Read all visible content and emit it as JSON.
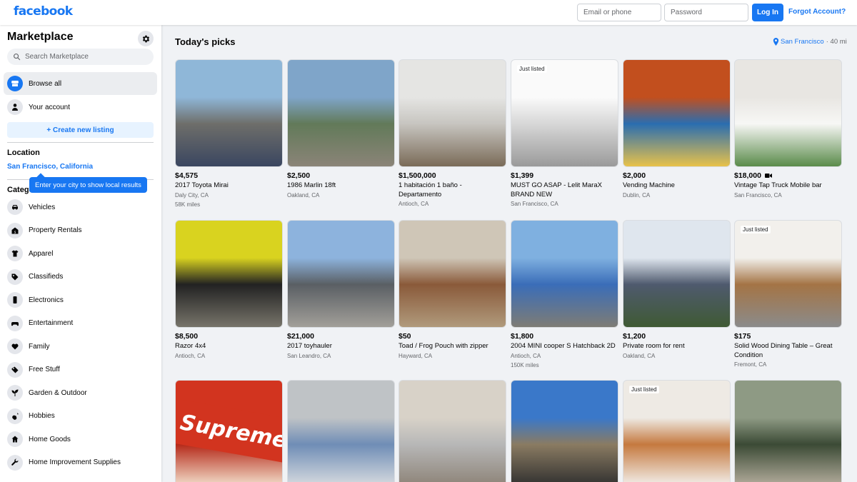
{
  "header": {
    "logo": "facebook",
    "email_placeholder": "Email or phone",
    "password_placeholder": "Password",
    "login_label": "Log In",
    "forgot_label": "Forgot Account?"
  },
  "sidebar": {
    "title": "Marketplace",
    "search_placeholder": "Search Marketplace",
    "nav": [
      {
        "label": "Browse all",
        "icon": "storefront-icon"
      },
      {
        "label": "Your account",
        "icon": "person-icon"
      }
    ],
    "create_label": "+ Create new listing",
    "location_header": "Location",
    "location_value": "San Francisco, California",
    "tooltip": "Enter your city to show local results",
    "categories_header": "Categories",
    "categories": [
      {
        "label": "Vehicles",
        "icon": "car-icon"
      },
      {
        "label": "Property Rentals",
        "icon": "house-dollar-icon"
      },
      {
        "label": "Apparel",
        "icon": "shirt-icon"
      },
      {
        "label": "Classifieds",
        "icon": "tag-icon"
      },
      {
        "label": "Electronics",
        "icon": "phone-icon"
      },
      {
        "label": "Entertainment",
        "icon": "gamepad-icon"
      },
      {
        "label": "Family",
        "icon": "heart-icon"
      },
      {
        "label": "Free Stuff",
        "icon": "free-tag-icon"
      },
      {
        "label": "Garden & Outdoor",
        "icon": "plant-icon"
      },
      {
        "label": "Hobbies",
        "icon": "guitar-icon"
      },
      {
        "label": "Home Goods",
        "icon": "home-icon"
      },
      {
        "label": "Home Improvement Supplies",
        "icon": "wrench-icon"
      }
    ]
  },
  "main": {
    "title": "Today's picks",
    "location": "San Francisco",
    "distance": "· 40 mi",
    "listings": [
      {
        "price": "$4,575",
        "title": "2017 Toyota Mirai",
        "location": "Daly City, CA",
        "extra": "58K miles",
        "colors": [
          "#8fb7d8",
          "#6e6e6a",
          "#3a4660"
        ]
      },
      {
        "price": "$2,500",
        "title": "1986 Marlin 18ft",
        "location": "Oakland, CA",
        "extra": "",
        "colors": [
          "#7fa5c9",
          "#627a59",
          "#8b8478"
        ]
      },
      {
        "price": "$1,500,000",
        "title": "1 habitación 1 baño - Departamento",
        "location": "Antioch, CA",
        "extra": "",
        "colors": [
          "#e5e5e3",
          "#c7c5c0",
          "#7a6b58"
        ]
      },
      {
        "price": "$1,399",
        "title": "MUST GO ASAP - Lelit MaraX BRAND NEW",
        "location": "San Francisco, CA",
        "extra": "",
        "badge": "Just listed",
        "colors": [
          "#fafafa",
          "#d7d7d7",
          "#9a9a9a"
        ]
      },
      {
        "price": "$2,000",
        "title": "Vending Machine",
        "location": "Dublin, CA",
        "extra": "",
        "colors": [
          "#c24f1e",
          "#2a6db0",
          "#e8c24a"
        ]
      },
      {
        "price": "$18,000",
        "title": "Vintage Tap Truck Mobile bar",
        "location": "San Francisco, CA",
        "extra": "",
        "video": true,
        "colors": [
          "#e8e6e2",
          "#f7f7f5",
          "#5a8b4a"
        ]
      },
      {
        "price": "$8,500",
        "title": "Razor 4x4",
        "location": "Antioch, CA",
        "extra": "",
        "colors": [
          "#d9d31f",
          "#222222",
          "#77746a"
        ]
      },
      {
        "price": "$21,000",
        "title": "2017 toyhauler",
        "location": "San Leandro, CA",
        "extra": "",
        "colors": [
          "#8db3dd",
          "#5a5f64",
          "#a29f99"
        ]
      },
      {
        "price": "$50",
        "title": "Toad / Frog Pouch with zipper",
        "location": "Hayward, CA",
        "extra": "",
        "colors": [
          "#cfc6b7",
          "#8a5a3a",
          "#b09a7c"
        ]
      },
      {
        "price": "$1,800",
        "title": "2004 MINI cooper S Hatchback 2D",
        "location": "Antioch, CA",
        "extra": "150K miles",
        "colors": [
          "#7fb0e0",
          "#3a6db8",
          "#7e7c75"
        ]
      },
      {
        "price": "$1,200",
        "title": "Private room for rent",
        "location": "Oakland, CA",
        "extra": "",
        "colors": [
          "#dfe6ee",
          "#4f5a6e",
          "#3f5a34"
        ]
      },
      {
        "price": "$175",
        "title": "Solid Wood Dining Table – Great Condition",
        "location": "Fremont, CA",
        "extra": "",
        "badge": "Just listed",
        "colors": [
          "#f2f0ec",
          "#a47445",
          "#8b8b8b"
        ]
      },
      {
        "price": "",
        "title": "",
        "location": "",
        "extra": "",
        "logo_text": "Supreme",
        "colors": [
          "#d2341f",
          "#b52a1a",
          "#f4e4d0"
        ]
      },
      {
        "price": "",
        "title": "",
        "location": "",
        "extra": "",
        "colors": [
          "#bfc3c6",
          "#6f8db6",
          "#dadde0"
        ]
      },
      {
        "price": "",
        "title": "",
        "location": "",
        "extra": "",
        "colors": [
          "#d8d2c8",
          "#b7b7b7",
          "#8c8276"
        ]
      },
      {
        "price": "",
        "title": "",
        "location": "",
        "extra": "",
        "colors": [
          "#3a78c9",
          "#8a7b62",
          "#2e2e2e"
        ]
      },
      {
        "price": "",
        "title": "",
        "location": "",
        "extra": "",
        "badge": "Just listed",
        "colors": [
          "#eeeae4",
          "#c5793f",
          "#f4f4f2"
        ]
      },
      {
        "price": "",
        "title": "",
        "location": "",
        "extra": "",
        "colors": [
          "#8e9a84",
          "#3b4a35",
          "#b8b0a0"
        ]
      }
    ]
  }
}
